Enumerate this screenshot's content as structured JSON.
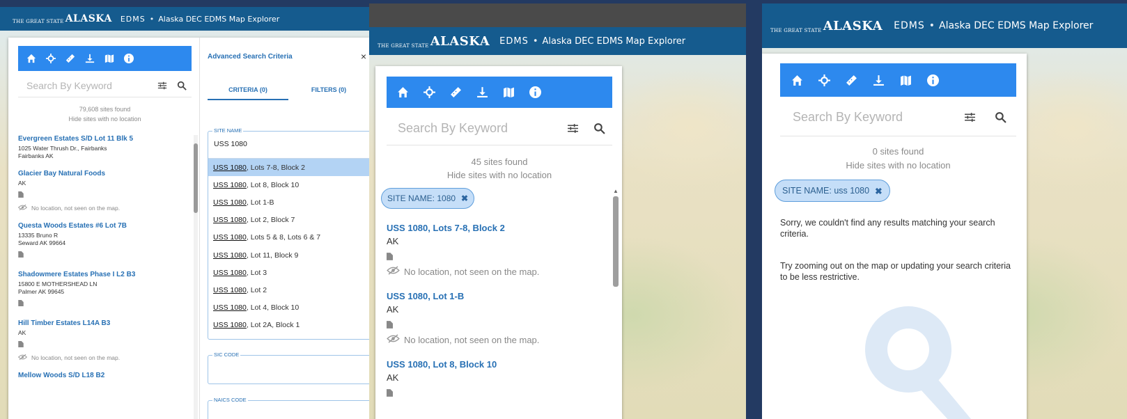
{
  "header": {
    "logo_small": "THE GREAT STATE",
    "logo_big": "ALASKA",
    "brand": "EDMS",
    "separator": "•",
    "app_title": "Alaska DEC EDMS Map Explorer"
  },
  "toolbar": {
    "icons": [
      "home-icon",
      "crosshair-icon",
      "measure-icon",
      "download-icon",
      "map-icon",
      "info-icon"
    ]
  },
  "search": {
    "placeholder": "Search By Keyword",
    "hide_label": "Hide sites with no location"
  },
  "panel1": {
    "found": "79,608 sites found",
    "results": [
      {
        "title": "Evergreen Estates S/D Lot 11 Blk 5",
        "lines": [
          "1025 Water Thrush Dr., Fairbanks",
          "Fairbanks AK"
        ],
        "doc": false,
        "noloc": false
      },
      {
        "title": "Glacier Bay Natural Foods",
        "lines": [
          "AK"
        ],
        "doc": true,
        "noloc": true
      },
      {
        "title": "Questa Woods Estates #6 Lot 7B",
        "lines": [
          "13335 Bruno R",
          "Seward AK 99664"
        ],
        "doc": true,
        "noloc": false
      },
      {
        "title": "Shadowmere Estates Phase I L2 B3",
        "lines": [
          "15800 E MOTHERSHEAD LN",
          "Palmer AK 99645"
        ],
        "doc": true,
        "noloc": false
      },
      {
        "title": "Hill Timber Estates L14A B3",
        "lines": [
          "AK"
        ],
        "doc": true,
        "noloc": true
      },
      {
        "title": "Mellow Woods S/D L18 B2",
        "lines": [],
        "doc": false,
        "noloc": false
      }
    ],
    "noloc_text": "No location, not seen on the map.",
    "advanced": {
      "title": "Advanced Search Criteria",
      "close": "×",
      "tab_criteria": "CRITERIA (0)",
      "tab_filters": "FILTERS (0)",
      "site_name_legend": "SITE NAME",
      "site_name_value": "USS 1080",
      "clear": "×",
      "match": "USS 1080",
      "options": [
        ", Lots 7-8, Block 2",
        ", Lot 8, Block 10",
        ", Lot 1-B",
        ", Lot 2, Block 7",
        ", Lots 5 & 8, Lots 6 & 7",
        ", Lot 11, Block 9",
        ", Lot 3",
        ", Lot 2",
        ", Lot 4, Block 10",
        ", Lot 2A, Block 1"
      ],
      "sic_legend": "SIC CODE",
      "naics_legend": "NAICS CODE"
    }
  },
  "panel2": {
    "found": "45 sites found",
    "chip": "SITE NAME: 1080",
    "chip_close": "✖",
    "results": [
      {
        "title": "USS 1080, Lots 7-8, Block 2",
        "sub": "AK",
        "noloc": true
      },
      {
        "title": "USS 1080, Lot 1-B",
        "sub": "AK",
        "noloc": true
      },
      {
        "title": "USS 1080, Lot 8, Block 10",
        "sub": "AK",
        "noloc": false
      }
    ],
    "noloc_text": "No location, not seen on the map."
  },
  "panel3": {
    "found": "0 sites found",
    "chip": "SITE NAME: uss 1080",
    "chip_close": "✖",
    "message1": "Sorry, we couldn't find any results matching your search criteria.",
    "message2": "Try zooming out on the map or updating your search criteria to be less restrictive."
  },
  "colors": {
    "header": "#155b8e",
    "toolbar": "#2d89ee",
    "link": "#2770b4",
    "chip_bg": "#c5def8",
    "background": "#233a62"
  }
}
